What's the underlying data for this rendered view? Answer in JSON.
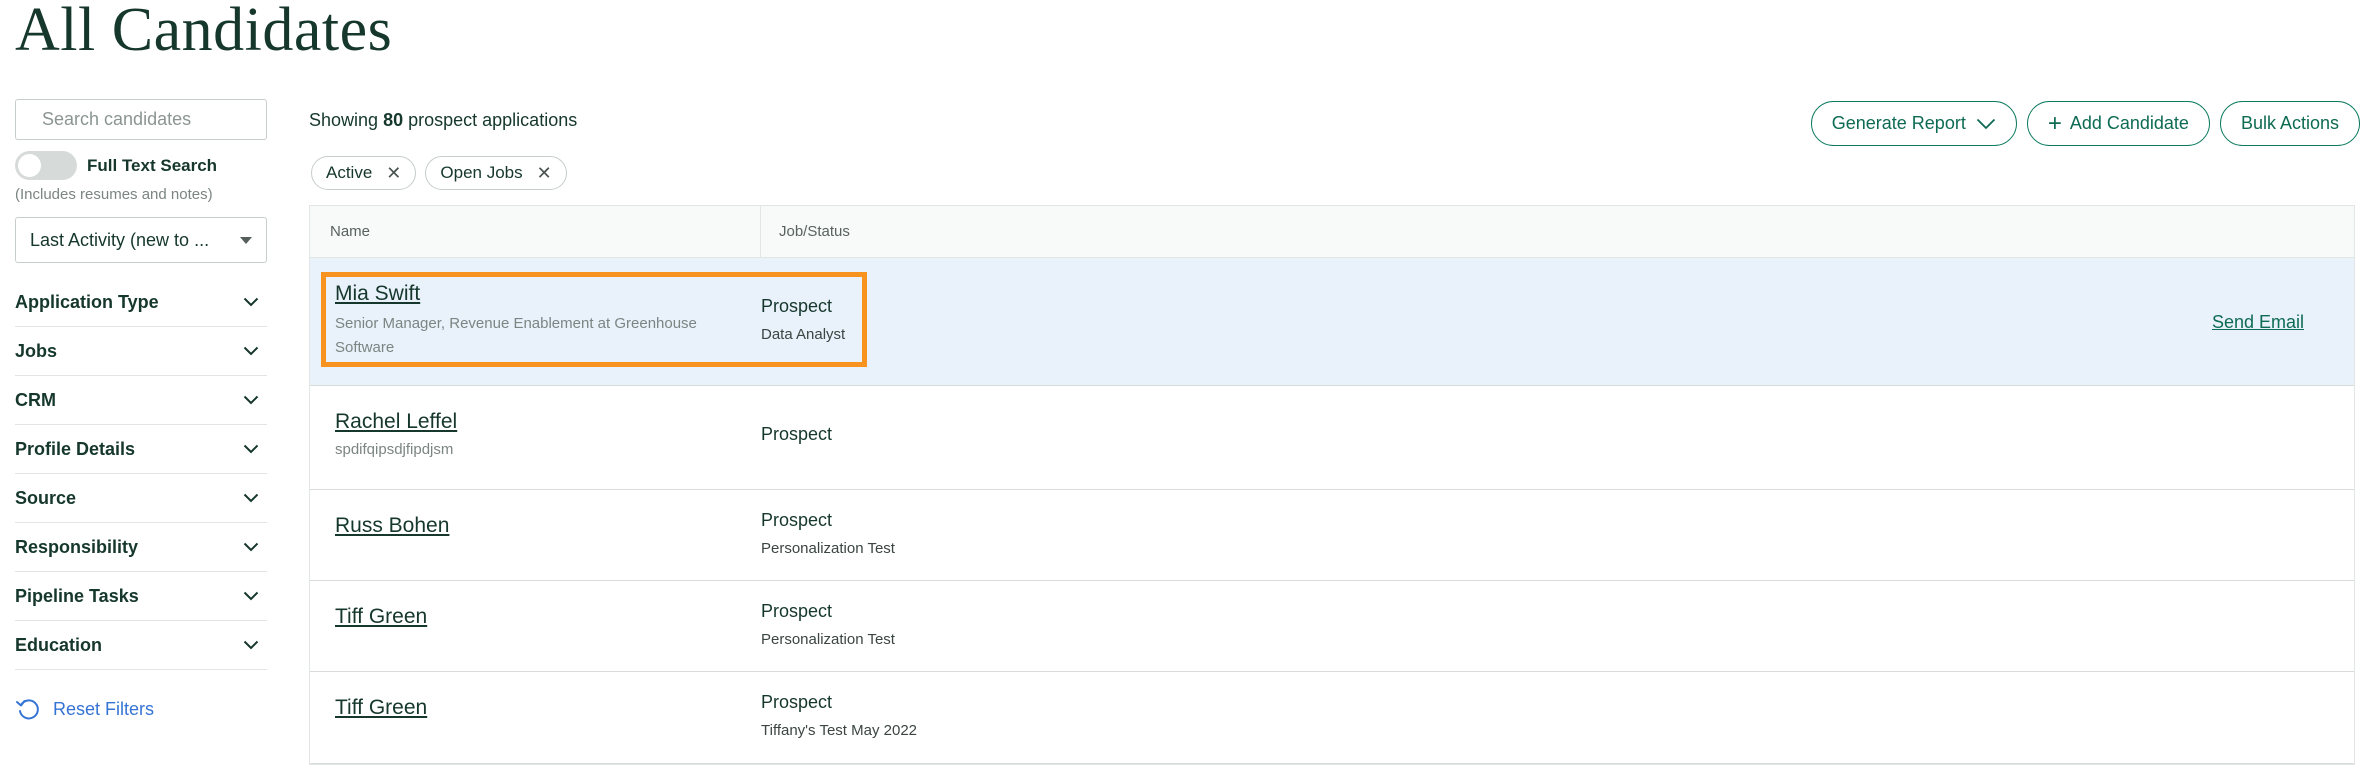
{
  "page": {
    "title": "All Candidates"
  },
  "sidebar": {
    "search_placeholder": "Search candidates",
    "full_text_search": {
      "label": "Full Text Search",
      "note": "(Includes resumes and notes)",
      "enabled": false
    },
    "sort": {
      "value": "Last Activity (new to ..."
    },
    "filters": [
      {
        "label": "Application Type"
      },
      {
        "label": "Jobs"
      },
      {
        "label": "CRM"
      },
      {
        "label": "Profile Details"
      },
      {
        "label": "Source"
      },
      {
        "label": "Responsibility"
      },
      {
        "label": "Pipeline Tasks"
      },
      {
        "label": "Education"
      }
    ],
    "reset_label": "Reset Filters"
  },
  "main": {
    "showing_prefix": "Showing",
    "showing_count": "80",
    "showing_suffix": "prospect applications",
    "chips": [
      {
        "label": "Active"
      },
      {
        "label": "Open Jobs"
      }
    ],
    "actions": {
      "generate_report": "Generate Report",
      "add_candidate": "Add Candidate",
      "bulk_actions": "Bulk Actions"
    },
    "table": {
      "columns": {
        "name": "Name",
        "job_status": "Job/Status"
      },
      "rows": [
        {
          "name": "Mia Swift",
          "subtitle": "Senior Manager, Revenue Enablement at Greenhouse Software",
          "status": "Prospect",
          "job": "Data Analyst",
          "action": "Send Email"
        },
        {
          "name": "Rachel Leffel",
          "subtitle": "spdifqipsdjfipdjsm",
          "status": "Prospect",
          "job": ""
        },
        {
          "name": "Russ Bohen",
          "subtitle": "",
          "status": "Prospect",
          "job": "Personalization Test"
        },
        {
          "name": "Tiff Green",
          "subtitle": "",
          "status": "Prospect",
          "job": "Personalization Test"
        },
        {
          "name": "Tiff Green",
          "subtitle": "",
          "status": "Prospect",
          "job": "Tiffany's Test May 2022"
        }
      ]
    }
  },
  "colors": {
    "brand_green": "#0d6b53",
    "title": "#15372c",
    "highlight": "#f7931e",
    "selected_row": "#e9f1fb",
    "link_blue": "#3574d4"
  }
}
